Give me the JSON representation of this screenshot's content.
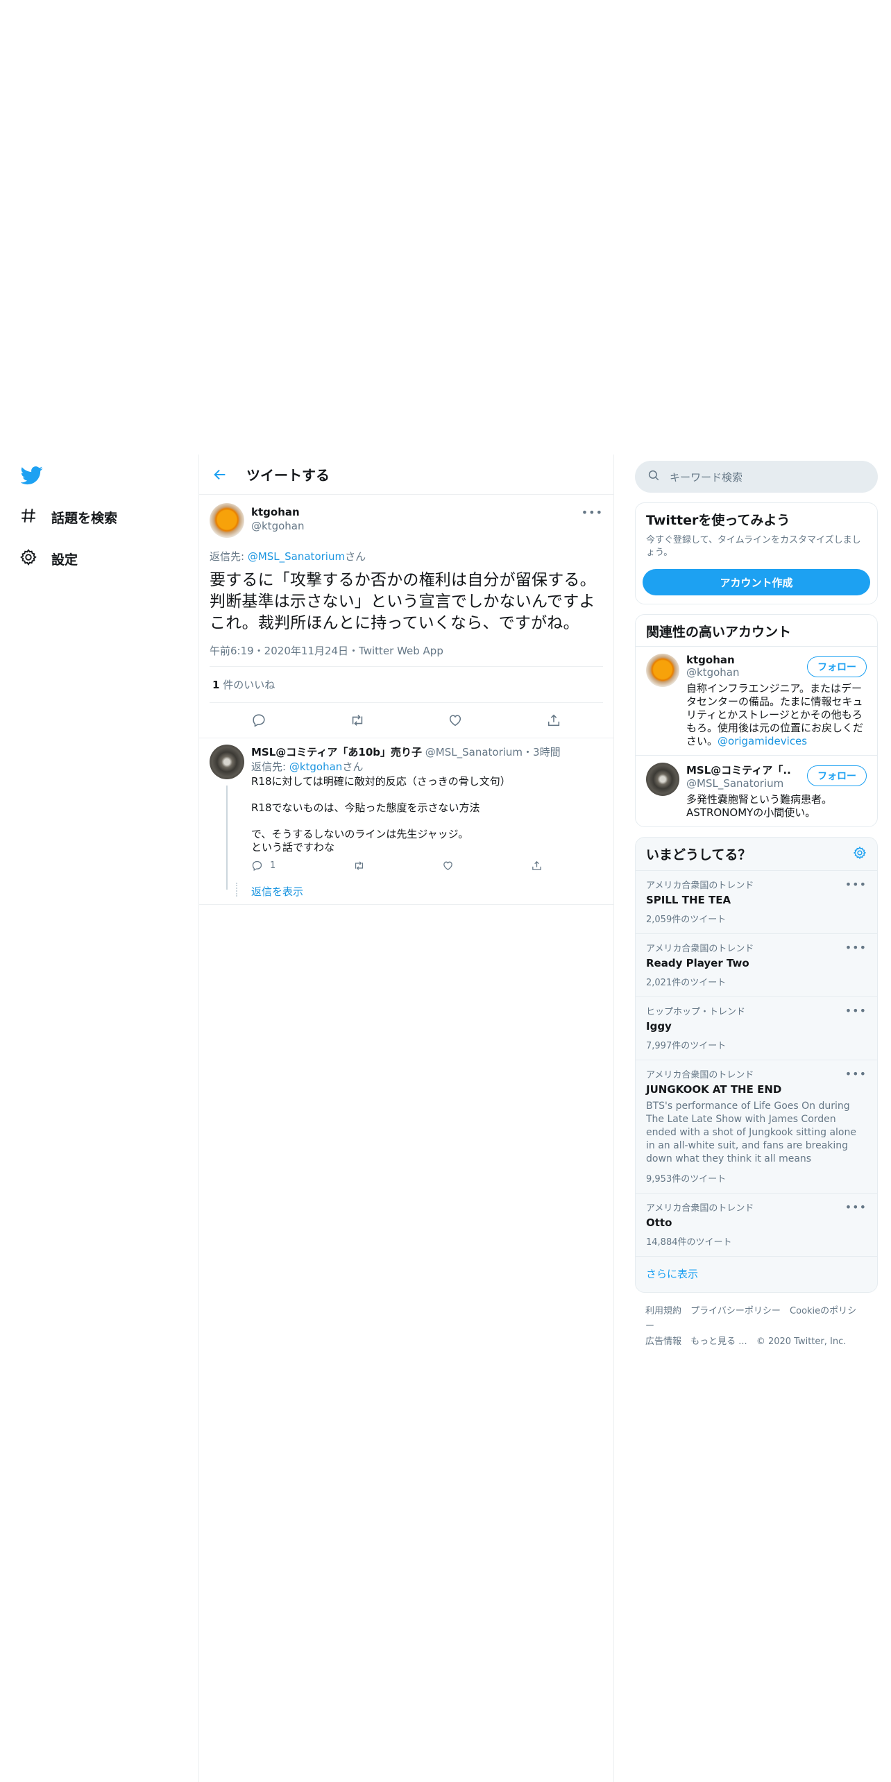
{
  "nav": {
    "explore_label": "話題を検索",
    "settings_label": "設定"
  },
  "header": {
    "title": "ツイートする"
  },
  "tweet": {
    "name": "ktgohan",
    "handle": "@ktgohan",
    "reply_to_prefix": "返信先: ",
    "reply_to_handle": "@MSL_Sanatorium",
    "reply_to_suffix": "さん",
    "text": "要するに「攻撃するか否かの権利は自分が留保する。判断基準は示さない」という宣言でしかないんですよこれ。裁判所ほんとに持っていくなら、ですがね。",
    "meta": "午前6:19・2020年11月24日・Twitter Web App",
    "likes_count": "1",
    "likes_label": " 件のいいね"
  },
  "reply": {
    "name": "MSL@コミティア「あ10b」売り子",
    "handle": "@MSL_Sanatorium",
    "time": "・3時間",
    "reply_to_prefix": "返信先: ",
    "reply_to_handle": "@ktgohan",
    "reply_to_suffix": "さん",
    "lines": [
      "R18に対しては明確に敵対的反応（さっきの骨し文句）",
      "",
      "R18でないものは、今貼った態度を示さない方法",
      "",
      "で、そうするしないのラインは先生ジャッジ。",
      "という話ですわな"
    ],
    "reply_count": "1",
    "show_replies": "返信を表示"
  },
  "sidebar": {
    "search_placeholder": "キーワード検索",
    "signup": {
      "title": "Twitterを使ってみよう",
      "subtitle": "今すぐ登録して、タイムラインをカスタマイズしましょう。",
      "button": "アカウント作成"
    },
    "related": {
      "title": "関連性の高いアカウント",
      "follow_label": "フォロー",
      "accounts": [
        {
          "name": "ktgohan",
          "handle": "@ktgohan",
          "bio": "自称インフラエンジニア。またはデータセンターの備品。たまに情報セキュリティとかストレージとかその他もろもろ。使用後は元の位置にお戻しください。",
          "bio_link": "@origamidevices"
        },
        {
          "name": "MSL@コミティア「...",
          "handle": "@MSL_Sanatorium",
          "bio": "多発性嚢胞腎という難病患者。ASTRONOMYの小間使い。",
          "bio_link": ""
        }
      ]
    },
    "trends": {
      "title": "いまどうしてる？",
      "items": [
        {
          "context": "アメリカ合衆国のトレンド",
          "name": "SPILL THE TEA",
          "desc": "",
          "count": "2,059件のツイート"
        },
        {
          "context": "アメリカ合衆国のトレンド",
          "name": "Ready Player Two",
          "desc": "",
          "count": "2,021件のツイート"
        },
        {
          "context": "ヒップホップ・トレンド",
          "name": "Iggy",
          "desc": "",
          "count": "7,997件のツイート"
        },
        {
          "context": "アメリカ合衆国のトレンド",
          "name": "JUNGKOOK AT THE END",
          "desc": "BTS's performance of Life Goes On during The Late Late Show with James Corden ended with a shot of Jungkook sitting alone in an all-white suit, and fans are breaking down what they think it all means",
          "count": "9,953件のツイート"
        },
        {
          "context": "アメリカ合衆国のトレンド",
          "name": "Otto",
          "desc": "",
          "count": "14,884件のツイート"
        }
      ],
      "show_more": "さらに表示"
    },
    "footer": {
      "links": [
        "利用規約",
        "プライバシーポリシー",
        "Cookieのポリシー",
        "広告情報",
        "もっと見る ..."
      ],
      "copyright": "© 2020 Twitter, Inc."
    }
  },
  "colors": {
    "accent": "#1da1f2",
    "link": "#1b95e0",
    "muted": "#657786"
  }
}
